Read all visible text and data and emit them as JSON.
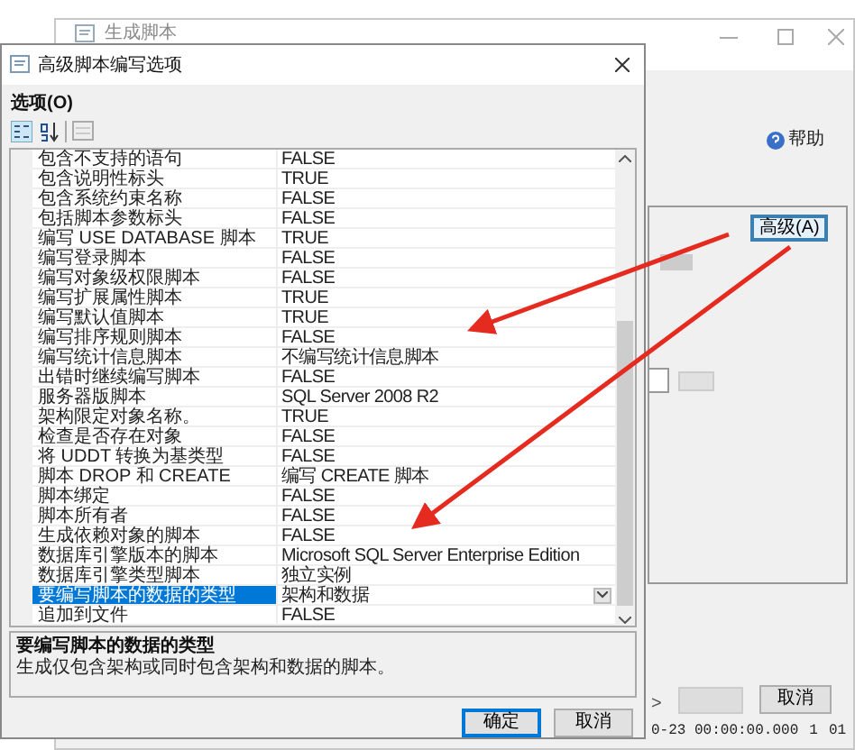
{
  "background_window": {
    "title": "生成脚本",
    "help": "帮助",
    "advanced_button": "高级(A)",
    "nav_button": ">",
    "cancel_button": "取消",
    "status_cells": [
      "0-23 00:00:00.000",
      "1",
      "01"
    ]
  },
  "dialog": {
    "title": "高级脚本编写选项",
    "section_label": "选项(O)",
    "properties": [
      {
        "name": "包含不支持的语句",
        "value": "FALSE",
        "selected": false
      },
      {
        "name": "包含说明性标头",
        "value": "TRUE",
        "selected": false
      },
      {
        "name": "包含系统约束名称",
        "value": "FALSE",
        "selected": false
      },
      {
        "name": "包括脚本参数标头",
        "value": "FALSE",
        "selected": false
      },
      {
        "name": "编写 USE DATABASE 脚本",
        "value": "TRUE",
        "selected": false
      },
      {
        "name": "编写登录脚本",
        "value": "FALSE",
        "selected": false
      },
      {
        "name": "编写对象级权限脚本",
        "value": "FALSE",
        "selected": false
      },
      {
        "name": "编写扩展属性脚本",
        "value": "TRUE",
        "selected": false
      },
      {
        "name": "编写默认值脚本",
        "value": "TRUE",
        "selected": false
      },
      {
        "name": "编写排序规则脚本",
        "value": "FALSE",
        "selected": false
      },
      {
        "name": "编写统计信息脚本",
        "value": "不编写统计信息脚本",
        "selected": false
      },
      {
        "name": "出错时继续编写脚本",
        "value": "FALSE",
        "selected": false
      },
      {
        "name": "服务器版脚本",
        "value": "SQL Server 2008 R2",
        "selected": false
      },
      {
        "name": "架构限定对象名称。",
        "value": "TRUE",
        "selected": false
      },
      {
        "name": "检查是否存在对象",
        "value": "FALSE",
        "selected": false
      },
      {
        "name": "将 UDDT 转换为基类型",
        "value": "FALSE",
        "selected": false
      },
      {
        "name": "脚本 DROP 和 CREATE",
        "value": "编写 CREATE 脚本",
        "selected": false
      },
      {
        "name": "脚本绑定",
        "value": "FALSE",
        "selected": false
      },
      {
        "name": "脚本所有者",
        "value": "FALSE",
        "selected": false
      },
      {
        "name": "生成依赖对象的脚本",
        "value": "FALSE",
        "selected": false
      },
      {
        "name": "数据库引擎版本的脚本",
        "value": "Microsoft SQL Server Enterprise Edition",
        "selected": false
      },
      {
        "name": "数据库引擎类型脚本",
        "value": "独立实例",
        "selected": false
      },
      {
        "name": "要编写脚本的数据的类型",
        "value": "架构和数据",
        "selected": true
      },
      {
        "name": "追加到文件",
        "value": "FALSE",
        "selected": false
      }
    ],
    "description": {
      "title": "要编写脚本的数据的类型",
      "text": "生成仅包含架构或同时包含架构和数据的脚本。"
    },
    "buttons": [
      {
        "label": "确定",
        "default": true
      },
      {
        "label": "取消",
        "default": false
      }
    ]
  }
}
